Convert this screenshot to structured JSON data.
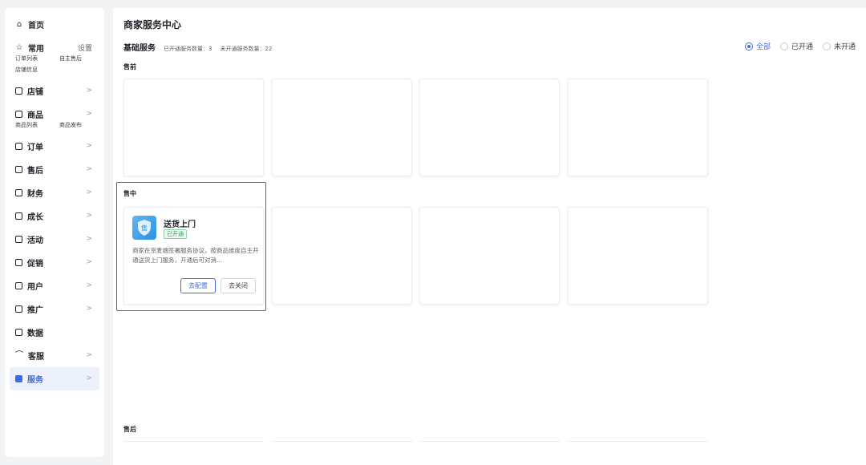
{
  "sidebar": {
    "home": "首页",
    "common": {
      "label": "常用",
      "settings": "设置",
      "links": [
        "订单列表",
        "自主售后",
        "店铺信息"
      ]
    },
    "shop": "店铺",
    "product": {
      "label": "商品",
      "links": [
        "商品列表",
        "商品发布"
      ]
    },
    "menu": [
      "订单",
      "售后",
      "财务",
      "成长",
      "活动",
      "促销",
      "用户",
      "推广"
    ],
    "data": "数据",
    "service_desk": "客服",
    "services": "服务"
  },
  "main": {
    "title": "商家服务中心",
    "basic_title": "基础服务",
    "opened_count": "已开通服务数量：3",
    "unopened_count": "未开通服务数量：22",
    "filters": [
      "全部",
      "已开通",
      "未开通"
    ],
    "selected_filter": "全部",
    "sections": [
      "售前",
      "售中",
      "售后"
    ],
    "card": {
      "icon": "shield-icon",
      "icon_glyph": "售",
      "name": "送货上门",
      "status": "已开通",
      "desc": "商家在京麦端签署服务协议，按商品维度自主开通送货上门服务，开通后可对消...",
      "configure": "去配置",
      "close": "去关闭"
    }
  },
  "colors": {
    "accent": "#3f6cdb",
    "highlight": "#d9382e",
    "success": "#2e9b59"
  }
}
